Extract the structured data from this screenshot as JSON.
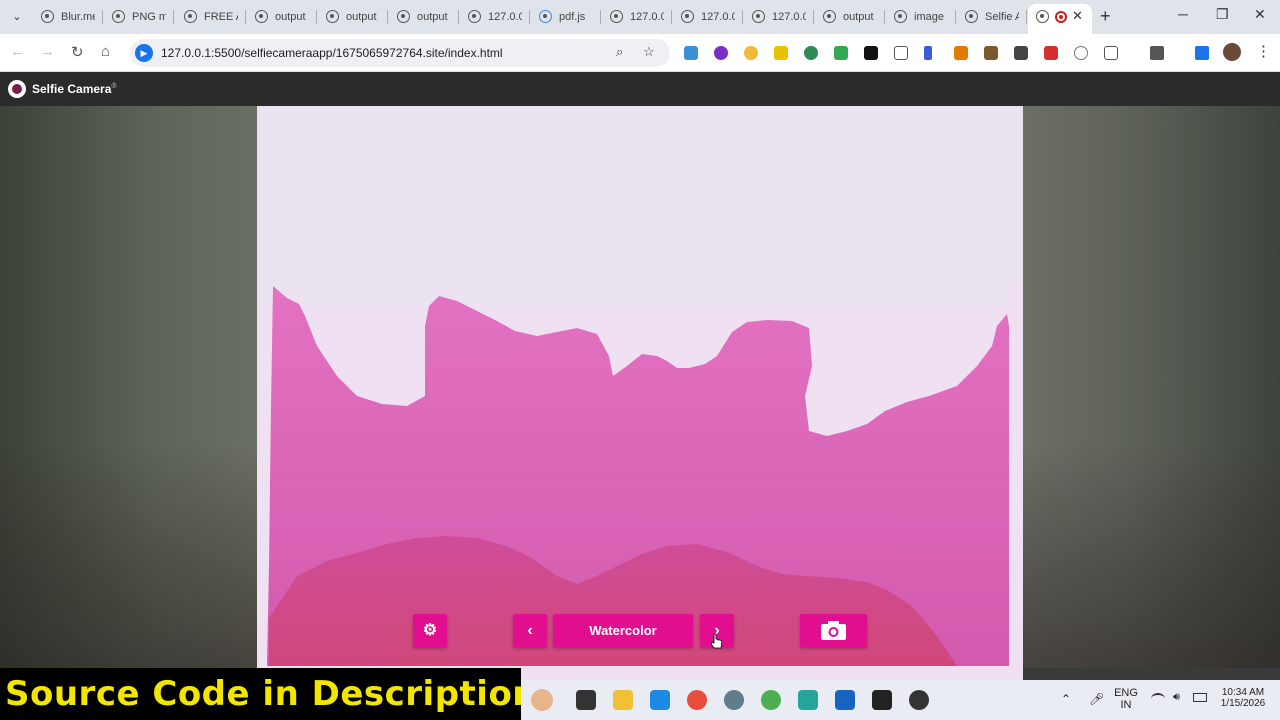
{
  "browser": {
    "tabs": [
      {
        "label": "Blur.me"
      },
      {
        "label": "PNG m"
      },
      {
        "label": "FREE A"
      },
      {
        "label": "output"
      },
      {
        "label": "output"
      },
      {
        "label": "output"
      },
      {
        "label": "127.0.0"
      },
      {
        "label": "pdf.js"
      },
      {
        "label": "127.0.0"
      },
      {
        "label": "127.0.0"
      },
      {
        "label": "127.0.0"
      },
      {
        "label": "output"
      },
      {
        "label": "image"
      },
      {
        "label": "Selfie A"
      }
    ],
    "active_tab_close": "✕",
    "new_tab": "+",
    "address": "127.0.0.1:5500/selfiecameraapp/1675065972764.site/index.html"
  },
  "app": {
    "title": "Selfie Camera",
    "title_mark": "®",
    "filter_name": "Watercolor",
    "accent": "#e10f8f"
  },
  "overlay": {
    "text": "Source Code in  Description"
  },
  "system": {
    "lang": "ENG",
    "region": "IN",
    "time": "10:34 AM",
    "date": "1/15/2026"
  }
}
